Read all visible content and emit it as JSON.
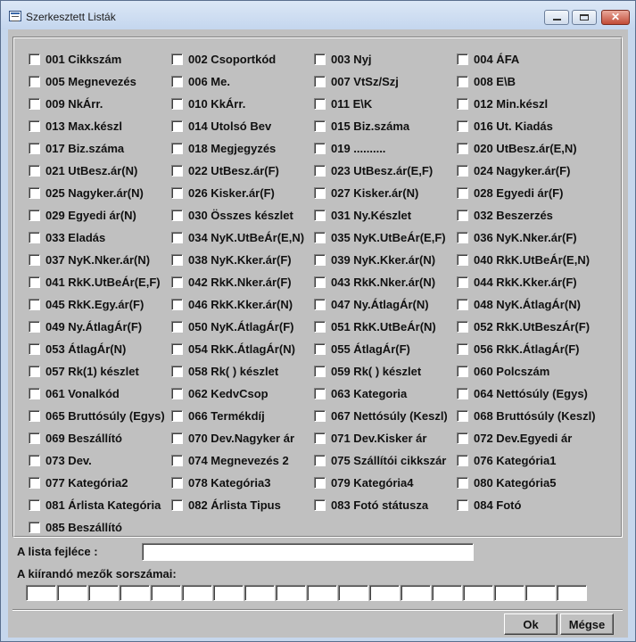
{
  "window": {
    "title": "Szerkesztett Listák"
  },
  "fields": [
    "001 Cikkszám",
    "002 Csoportkód",
    "003 Nyj",
    "004 ÁFA",
    "005 Megnevezés",
    "006 Me.",
    "007 VtSz/Szj",
    "008 E\\B",
    "009 NkÁrr.",
    "010 KkÁrr.",
    "011 E\\K",
    "012 Min.készl",
    "013 Max.készl",
    "014 Utolsó Bev",
    "015 Biz.száma",
    "016 Ut. Kiadás",
    "017 Biz.száma",
    "018 Megjegyzés",
    "019 ..........",
    "020 UtBesz.ár(E,N)",
    "021 UtBesz.ár(N)",
    "022 UtBesz.ár(F)",
    "023 UtBesz.ár(E,F)",
    "024 Nagyker.ár(F)",
    "025 Nagyker.ár(N)",
    "026 Kisker.ár(F)",
    "027 Kisker.ár(N)",
    "028 Egyedi ár(F)",
    "029 Egyedi ár(N)",
    "030 Összes készlet",
    "031 Ny.Készlet",
    "032 Beszerzés",
    "033 Eladás",
    "034 NyK.UtBeÁr(E,N)",
    "035 NyK.UtBeÁr(E,F)",
    "036 NyK.Nker.ár(F)",
    "037 NyK.Nker.ár(N)",
    "038 NyK.Kker.ár(F)",
    "039 NyK.Kker.ár(N)",
    "040 RkK.UtBeÁr(E,N)",
    "041 RkK.UtBeÁr(E,F)",
    "042 RkK.Nker.ár(F)",
    "043 RkK.Nker.ár(N)",
    "044 RkK.Kker.ár(F)",
    "045 RkK.Egy.ár(F)",
    "046 RkK.Kker.ár(N)",
    "047 Ny.ÁtlagÁr(N)",
    "048 NyK.ÁtlagÁr(N)",
    "049 Ny.ÁtlagÁr(F)",
    "050 NyK.ÁtlagÁr(F)",
    "051 RkK.UtBeÁr(N)",
    "052 RkK.UtBeszÁr(F)",
    "053 ÁtlagÁr(N)",
    "054 RkK.ÁtlagÁr(N)",
    "055 ÁtlagÁr(F)",
    "056 RkK.ÁtlagÁr(F)",
    "057 Rk(1) készlet",
    "058 Rk( ) készlet",
    "059 Rk( ) készlet",
    "060 Polcszám",
    "061 Vonalkód",
    "062 KedvCsop",
    "063 Kategoria",
    "064 Nettósúly (Egys)",
    "065 Bruttósúly (Egys)",
    "066 Termékdíj",
    "067 Nettósúly (Keszl)",
    "068 Bruttósúly (Keszl)",
    "069 Beszállító",
    "070 Dev.Nagyker ár",
    "071 Dev.Kisker ár",
    "072 Dev.Egyedi ár",
    "073 Dev.",
    "074 Megnevezés 2",
    "075 Szállítói cikkszár",
    "076 Kategória1",
    "077 Kategória2",
    "078 Kategória3",
    "079 Kategória4",
    "080 Kategória5",
    "081 Árlista Kategória",
    "082 Árlista Tipus",
    "083 Fotó státusza",
    "084 Fotó",
    "085 Beszállító"
  ],
  "header_label": "A lista fejléce :",
  "header_value": "",
  "fields_label": "A kiírandó mezők sorszámai:",
  "field_number_count": 18,
  "buttons": {
    "ok": "Ok",
    "cancel": "Mégse"
  },
  "colors": {
    "titlebar": "#c6d7ec",
    "client": "#c0c0c0",
    "close": "#c24b36"
  }
}
